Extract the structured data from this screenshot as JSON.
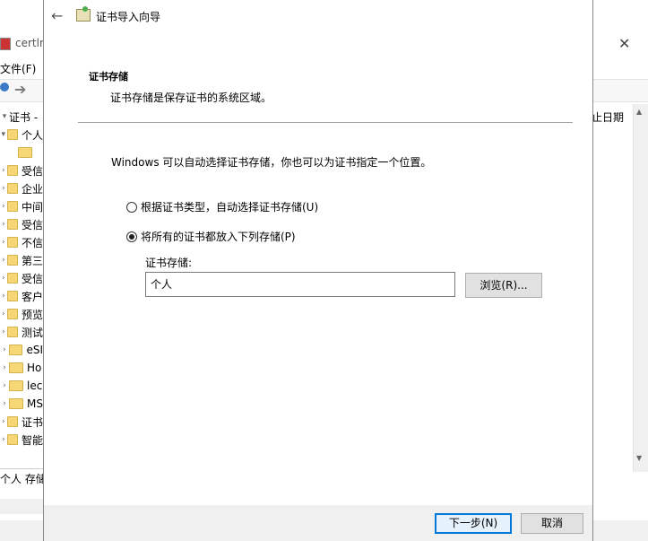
{
  "background_window": {
    "title": "certlm",
    "menu_file": "文件(F)",
    "column_header": "止日期",
    "tree_root": "证书 -",
    "tree_items": [
      "个人",
      "",
      "受信",
      "企业",
      "中间",
      "受信",
      "不信",
      "第三",
      "受信",
      "客户",
      "预览",
      "测试",
      "eSI",
      "Ho",
      "lec",
      "MS",
      "证书",
      "智能"
    ],
    "status_text": "个人 存储不"
  },
  "wizard": {
    "title": "证书导入向导",
    "section_title": "证书存储",
    "section_desc": "证书存储是保存证书的系统区域。",
    "intro": "Windows 可以自动选择证书存储，你也可以为证书指定一个位置。",
    "radio_auto": "根据证书类型，自动选择证书存储(U)",
    "radio_manual": "将所有的证书都放入下列存储(P)",
    "store_label": "证书存储:",
    "store_value": "个人",
    "browse_label": "浏览(R)...",
    "next_label": "下一步(N)",
    "cancel_label": "取消"
  },
  "colors": {
    "accent": "#0078d7",
    "folder": "#f6d776"
  },
  "icons": [
    "back-arrow-icon",
    "certificate-wizard-icon",
    "folder-icon",
    "close-icon"
  ]
}
